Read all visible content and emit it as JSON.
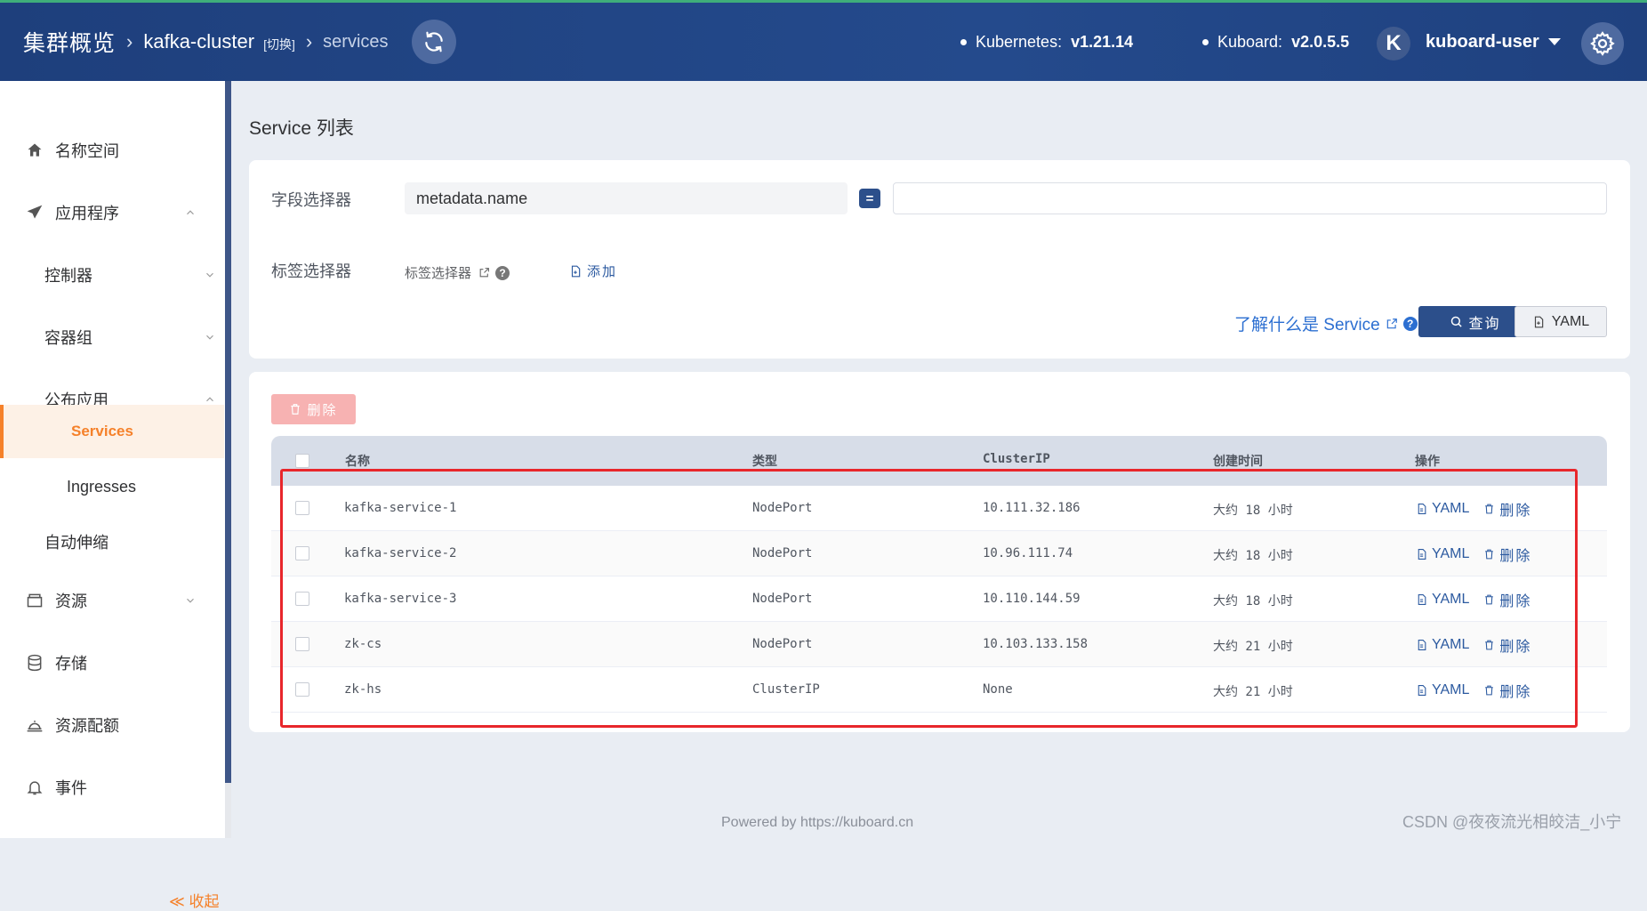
{
  "header": {
    "breadcrumb_home": "集群概览",
    "cluster_name": "kafka-cluster",
    "switch_label": "[切换]",
    "current_page": "services",
    "kubernetes_label": "Kubernetes:",
    "kubernetes_version": "v1.21.14",
    "kuboard_label": "Kuboard:",
    "kuboard_version": "v2.0.5.5",
    "avatar_letter": "K",
    "username": "kuboard-user"
  },
  "sidebar": {
    "items": [
      {
        "label": "名称空间",
        "icon": "home-icon"
      },
      {
        "label": "应用程序",
        "icon": "paper-plane-icon"
      },
      {
        "label": "控制器"
      },
      {
        "label": "容器组"
      },
      {
        "label": "公布应用"
      },
      {
        "label": "Services"
      },
      {
        "label": "Ingresses"
      },
      {
        "label": "自动伸缩"
      },
      {
        "label": "资源",
        "icon": "inbox-icon"
      },
      {
        "label": "存储",
        "icon": "database-icon"
      },
      {
        "label": "资源配额",
        "icon": "cloche-icon"
      },
      {
        "label": "事件",
        "icon": "bell-icon"
      }
    ],
    "collapse_label": "≪ 收起"
  },
  "main": {
    "title": "Service 列表",
    "filter": {
      "field_selector_label": "字段选择器",
      "field_value": "metadata.name",
      "operator": "=",
      "label_selector_label": "标签选择器",
      "label_selector_link": "标签选择器",
      "add_label": "添加",
      "learn_link": "了解什么是 Service",
      "query_button": "查询",
      "yaml_button": "YAML"
    },
    "delete_button": "删除",
    "table": {
      "columns": [
        "名称",
        "类型",
        "ClusterIP",
        "创建时间",
        "操作"
      ],
      "rows": [
        {
          "name": "kafka-service-1",
          "type": "NodePort",
          "cluster_ip": "10.111.32.186",
          "created": "大约 18 小时"
        },
        {
          "name": "kafka-service-2",
          "type": "NodePort",
          "cluster_ip": "10.96.111.74",
          "created": "大约 18 小时"
        },
        {
          "name": "kafka-service-3",
          "type": "NodePort",
          "cluster_ip": "10.110.144.59",
          "created": "大约 18 小时"
        },
        {
          "name": "zk-cs",
          "type": "NodePort",
          "cluster_ip": "10.103.133.158",
          "created": "大约 21 小时"
        },
        {
          "name": "zk-hs",
          "type": "ClusterIP",
          "cluster_ip": "None",
          "created": "大约 21 小时"
        }
      ],
      "op_yaml": "YAML",
      "op_delete": "删除"
    }
  },
  "footer": {
    "powered_by": "Powered by https://kuboard.cn"
  },
  "watermark": "CSDN @夜夜流光相皎洁_小宁",
  "colors": {
    "header_bg": "#244a8c",
    "accent_orange": "#f5812a",
    "primary_blue": "#2c4f8b",
    "highlight_red": "#e8262b"
  }
}
